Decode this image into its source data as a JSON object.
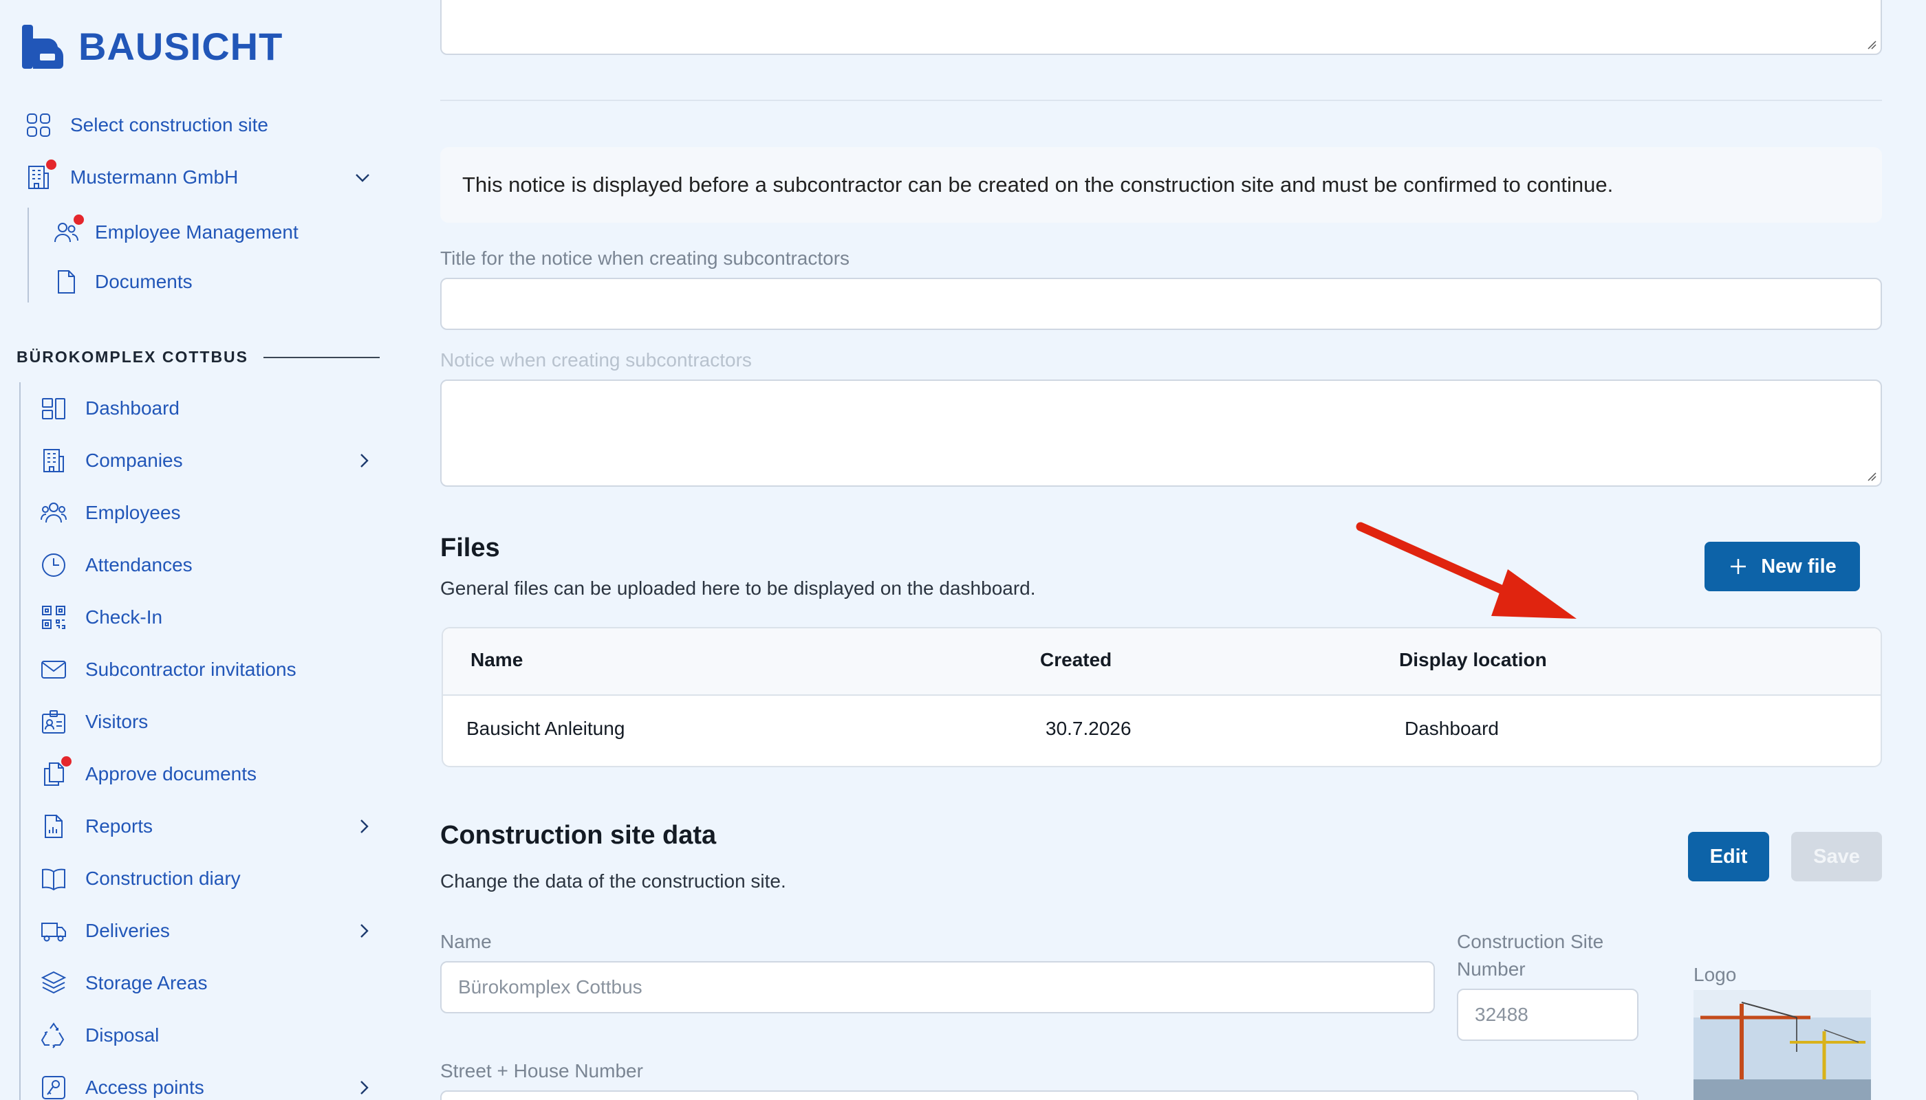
{
  "brand": {
    "name": "BAUSICHT",
    "color": "#2156b8"
  },
  "top_nav": {
    "select_site": {
      "label": "Select construction site",
      "icon": "grid-icon"
    },
    "company": {
      "label": "Mustermann GmbH",
      "icon": "building-icon",
      "has_notification": true
    },
    "employee_management": {
      "label": "Employee Management",
      "icon": "users-icon",
      "has_notification": true
    },
    "documents": {
      "label": "Documents",
      "icon": "document-icon"
    }
  },
  "site_section": {
    "title": "BÜROKOMPLEX COTTBUS",
    "items": [
      {
        "label": "Dashboard",
        "icon": "dashboard-icon",
        "has_submenu": false
      },
      {
        "label": "Companies",
        "icon": "building-icon",
        "has_submenu": true
      },
      {
        "label": "Employees",
        "icon": "users-group-icon",
        "has_submenu": false
      },
      {
        "label": "Attendances",
        "icon": "clock-icon",
        "has_submenu": false
      },
      {
        "label": "Check-In",
        "icon": "qr-code-icon",
        "has_submenu": false
      },
      {
        "label": "Subcontractor invitations",
        "icon": "envelope-icon",
        "has_submenu": false
      },
      {
        "label": "Visitors",
        "icon": "badge-icon",
        "has_submenu": false
      },
      {
        "label": "Approve documents",
        "icon": "documents-icon",
        "has_submenu": false,
        "has_notification": true
      },
      {
        "label": "Reports",
        "icon": "report-icon",
        "has_submenu": true
      },
      {
        "label": "Construction diary",
        "icon": "book-icon",
        "has_submenu": false
      },
      {
        "label": "Deliveries",
        "icon": "truck-icon",
        "has_submenu": true
      },
      {
        "label": "Storage Areas",
        "icon": "layers-icon",
        "has_submenu": false
      },
      {
        "label": "Disposal",
        "icon": "recycle-icon",
        "has_submenu": false
      },
      {
        "label": "Access points",
        "icon": "access-icon",
        "has_submenu": true
      }
    ]
  },
  "notice": {
    "info_text": "This notice is displayed before a subcontractor can be created on the construction site and must be confirmed to continue.",
    "title_label": "Title for the notice when creating subcontractors",
    "title_value": "",
    "body_label": "Notice when creating subcontractors",
    "body_value": ""
  },
  "files": {
    "heading": "Files",
    "description": "General files can be uploaded here to be displayed on the dashboard.",
    "new_button": "New file",
    "columns": [
      "Name",
      "Created",
      "Display location"
    ],
    "rows": [
      {
        "name": "Bausicht Anleitung",
        "created": "30.7.2026",
        "location": "Dashboard"
      }
    ]
  },
  "site_data": {
    "heading": "Construction site data",
    "description": "Change the data of the construction site.",
    "edit_button": "Edit",
    "save_button": "Save",
    "name_label": "Name",
    "name_value": "Bürokomplex Cottbus",
    "number_label_line1": "Construction Site",
    "number_label_line2": "Number",
    "number_value": "32488",
    "street_label": "Street + House Number",
    "logo_label": "Logo"
  },
  "colors": {
    "accent": "#2156b8",
    "button": "#0d63a8",
    "notification": "#e4262c",
    "annotation_arrow": "#e0240f"
  }
}
